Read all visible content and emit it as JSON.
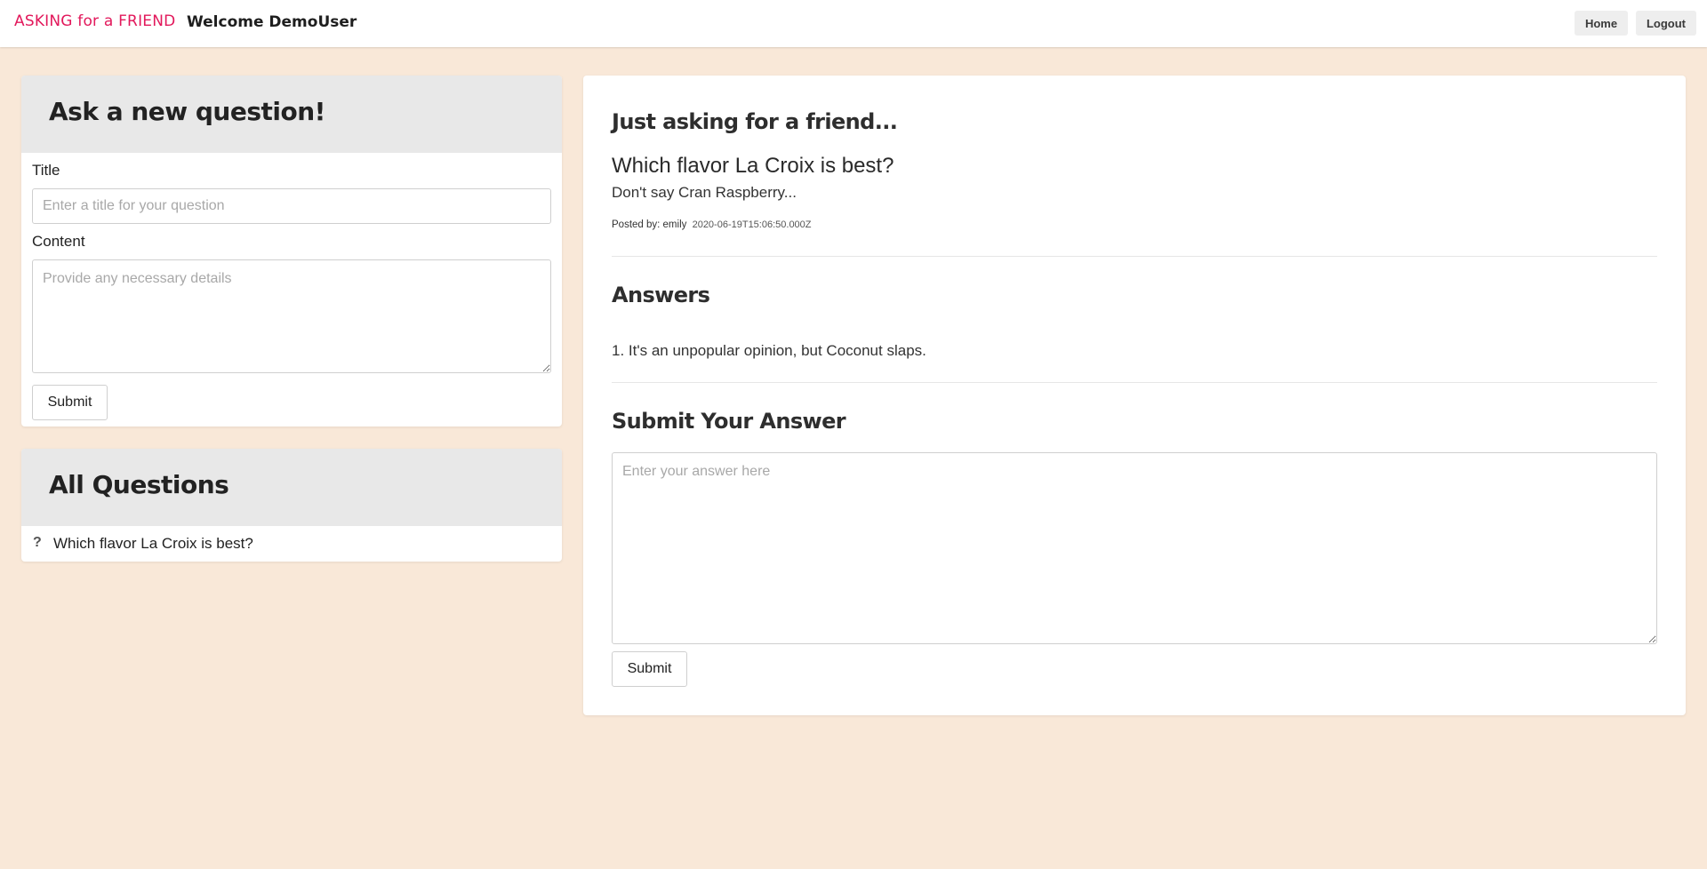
{
  "navbar": {
    "brand": "ASKING for a FRIEND",
    "welcome": "Welcome DemoUser",
    "home_label": "Home",
    "logout_label": "Logout"
  },
  "ask_form": {
    "heading": "Ask a new question!",
    "title_label": "Title",
    "title_placeholder": "Enter a title for your question",
    "content_label": "Content",
    "content_placeholder": "Provide any necessary details",
    "submit_label": "Submit"
  },
  "all_questions": {
    "heading": "All Questions",
    "items": [
      {
        "icon": "question-mark-icon",
        "title": "Which flavor La Croix is best?"
      }
    ]
  },
  "question_detail": {
    "heading": "Just asking for a friend...",
    "title": "Which flavor La Croix is best?",
    "content": "Don't say Cran Raspberry...",
    "posted_by_label": "Posted by: emily",
    "timestamp": "2020-06-19T15:06:50.000Z",
    "answers_heading": "Answers",
    "answers": [
      "1. It's an unpopular opinion, but Coconut slaps."
    ],
    "submit_answer_heading": "Submit Your Answer",
    "answer_placeholder": "Enter your answer here",
    "submit_label": "Submit"
  },
  "colors": {
    "page_background": "#f9e8d8",
    "brand": "#e2185b",
    "card_header": "#e8e8e8"
  }
}
